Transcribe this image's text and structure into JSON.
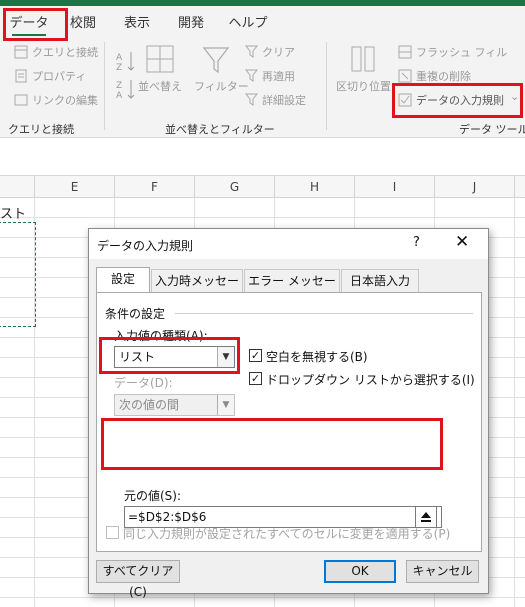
{
  "ribbon": {
    "tabs": [
      {
        "label": "データ"
      },
      {
        "label": "校閲"
      },
      {
        "label": "表示"
      },
      {
        "label": "開発"
      },
      {
        "label": "ヘルプ"
      }
    ],
    "queries_group": {
      "items": [
        "クエリと接続",
        "プロパティ",
        "リンクの編集"
      ],
      "name": "クエリと接続"
    },
    "sort_group": {
      "sort_label": "並べ替え",
      "filter_label": "フィルター",
      "clear_label": "クリア",
      "reapply_label": "再適用",
      "advanced_label": "詳細設定",
      "name": "並べ替えとフィルター"
    },
    "data_tools_group": {
      "text_to_columns_label": "区切り位置",
      "flash_fill_label": "フラッシュ フィル",
      "remove_duplicates_label": "重複の削除",
      "data_validation_label": "データの入力規則",
      "name": "データ ツール"
    }
  },
  "sheet": {
    "columns": [
      "E",
      "F",
      "G",
      "H",
      "I",
      "J"
    ],
    "cell_text": "スト"
  },
  "dialog": {
    "title": "データの入力規則",
    "help": "?",
    "close": "✕",
    "tabs": [
      "設定",
      "入力時メッセージ",
      "エラー メッセージ",
      "日本語入力"
    ],
    "section_title": "条件の設定",
    "allow_label": "入力値の種類(A):",
    "allow_value": "リスト",
    "ignore_blank_label": "空白を無視する(B)",
    "in_cell_dropdown_label": "ドロップダウン リストから選択する(I)",
    "data_label": "データ(D):",
    "data_value": "次の値の間",
    "source_label": "元の値(S):",
    "source_value": "=$D$2:$D$6",
    "apply_all_label": "同じ入力規則が設定されたすべてのセルに変更を適用する(P)",
    "clear_all_label": "すべてクリア(C)",
    "ok_label": "OK",
    "cancel_label": "キャンセル"
  }
}
